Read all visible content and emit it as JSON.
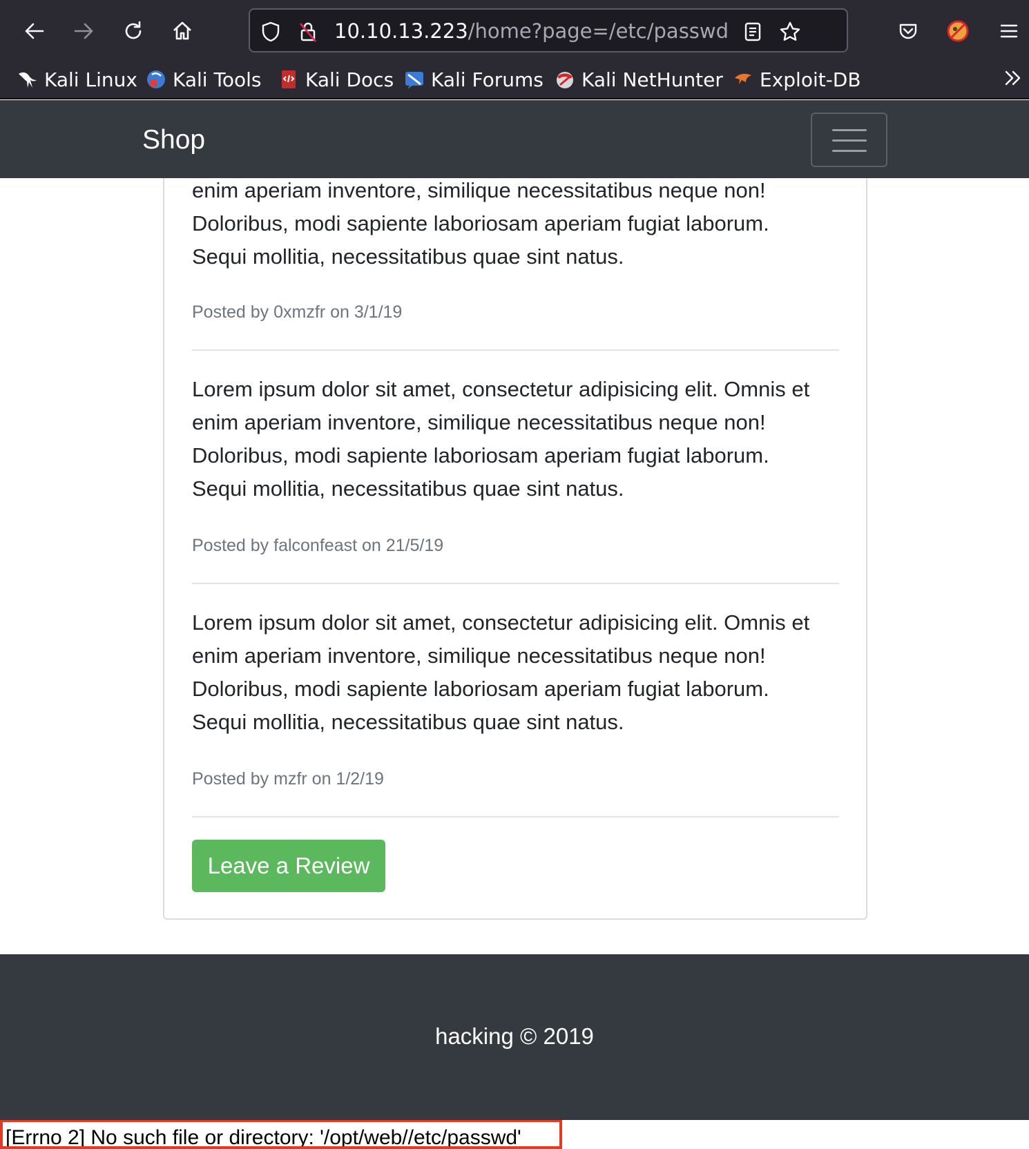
{
  "browser": {
    "url_host": "10.10.13.223",
    "url_path": "/home?page=/etc/passwd",
    "bookmarks": [
      "Kali Linux",
      "Kali Tools",
      "Kali Docs",
      "Kali Forums",
      "Kali NetHunter",
      "Exploit-DB"
    ]
  },
  "navbar": {
    "brand": "Shop"
  },
  "reviews": [
    {
      "lines": [
        "enim aperiam inventore, similique necessitatibus neque non!",
        "Doloribus, modi sapiente laboriosam aperiam fugiat laborum.",
        "Sequi mollitia, necessitatibus quae sint natus."
      ],
      "posted": "Posted by 0xmzfr on 3/1/19"
    },
    {
      "lines": [
        "Lorem ipsum dolor sit amet, consectetur adipisicing elit. Omnis et",
        "enim aperiam inventore, similique necessitatibus neque non!",
        "Doloribus, modi sapiente laboriosam aperiam fugiat laborum.",
        "Sequi mollitia, necessitatibus quae sint natus."
      ],
      "posted": "Posted by falconfeast on 21/5/19"
    },
    {
      "lines": [
        "Lorem ipsum dolor sit amet, consectetur adipisicing elit. Omnis et",
        "enim aperiam inventore, similique necessitatibus neque non!",
        "Doloribus, modi sapiente laboriosam aperiam fugiat laborum.",
        "Sequi mollitia, necessitatibus quae sint natus."
      ],
      "posted": "Posted by mzfr on 1/2/19"
    }
  ],
  "leave_review_label": "Leave a Review",
  "footer": {
    "text": "hacking © 2019"
  },
  "error_message": "[Errno 2] No such file or directory: '/opt/web//etc/passwd'"
}
